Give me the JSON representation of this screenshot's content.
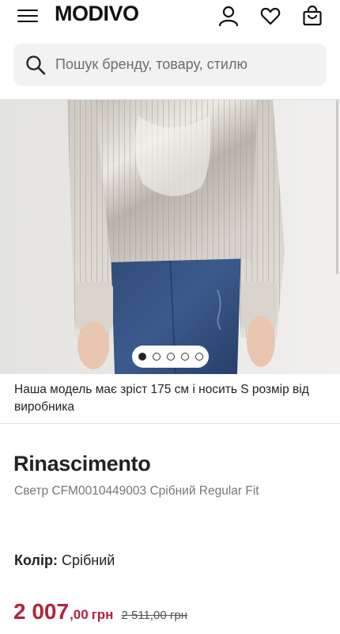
{
  "header": {
    "logo": "MODIVO",
    "menu_icon": "hamburger-menu-icon",
    "account_icon": "user-icon",
    "wishlist_icon": "heart-icon",
    "cart_icon": "shopping-bag-icon"
  },
  "search": {
    "placeholder": "Пошук бренду, товару, стилю",
    "icon": "search-icon"
  },
  "gallery": {
    "slide_count": 5,
    "active_slide": 1
  },
  "product": {
    "model_note": "Наша модель має зріст 175 см і носить S розмір від виробника",
    "brand": "Rinascimento",
    "name": "Светр CFM0010449003 Срібний Regular Fit",
    "color_label": "Колір:",
    "color_value": "Срібний",
    "price_main": "2 007",
    "price_decimals": ",00",
    "price_currency": "грн",
    "price_old": "2 511,00 грн"
  },
  "colors": {
    "price_accent": "#b0243b",
    "search_bg": "#f2f2f2"
  }
}
